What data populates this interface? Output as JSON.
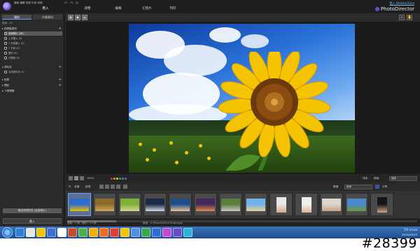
{
  "titlebar": {
    "menu_items": [
      "檔案",
      "編輯",
      "檢視",
      "外掛",
      "說明",
      "說明"
    ],
    "undo_glyphs": [
      "↶",
      "↷",
      "⟳"
    ],
    "modes": [
      "匯入",
      "調整",
      "編輯",
      "幻燈片",
      "列印"
    ],
    "active_mode": "匯入",
    "signin_label": "登入 DirectorZone",
    "brand_name": "PhotoDirector"
  },
  "left_panel": {
    "tabs": [
      "資料",
      "作業資料"
    ],
    "search_label": "搜尋：all",
    "sections": [
      {
        "label": "▸ 相簿監視夾",
        "items": [
          {
            "label": "全部相片 (28)",
            "selected": true
          },
          {
            "label": "上次匯入 (0)",
            "selected": false
          },
          {
            "label": "1 天前匯入 (0)",
            "selected": false
          },
          {
            "label": "7 天前 (0)",
            "selected": false
          },
          {
            "label": "歷史 (0)",
            "selected": false
          },
          {
            "label": "已刪除 (0)",
            "selected": false
          }
        ]
      },
      {
        "label": "▸ 資料夾",
        "items": [
          {
            "label": "共用資料夾 (1)",
            "selected": false
          }
        ]
      },
      {
        "label": "▸ 相簿",
        "items": []
      },
      {
        "label": "▸ 標記",
        "items": []
      },
      {
        "label": "▸ 人物標籤",
        "items": []
      }
    ],
    "bottom_button_1": "匯出到資料夾 (全部相片)",
    "bottom_button_2": "匯入"
  },
  "viewer_toolbar": {
    "view_buttons": [
      "▦",
      "▣",
      "▤"
    ],
    "right_buttons": [
      "⌕",
      "✋"
    ]
  },
  "filmstrip_toolbar": {
    "zoom_label": "100%",
    "sort_label": "排序：",
    "sort_value": "名稱",
    "view_label": "檢視",
    "group_label": "群組：",
    "group_value": "檔案",
    "search_label": "篩選",
    "search_placeholder": "搜尋",
    "facebook_label": "分享",
    "color_labels": [
      "#d83a3a",
      "#e59b2b",
      "#e4d33a",
      "#3fa94a",
      "#3a82d8",
      "#8a55c9"
    ]
  },
  "filmstrip": {
    "thumbnails": [
      {
        "name": "sunflower-thumb",
        "selected": true,
        "colors": [
          "#2d6bd0",
          "#f0c000"
        ]
      },
      {
        "name": "spiral-thumb",
        "selected": false,
        "colors": [
          "#8c6c2c",
          "#d0a85a"
        ]
      },
      {
        "name": "grass-thumb",
        "selected": false,
        "colors": [
          "#7fae3a",
          "#d6d98c"
        ]
      },
      {
        "name": "lake-thumb",
        "selected": false,
        "colors": [
          "#1a2a46",
          "#d7dce6"
        ]
      },
      {
        "name": "coast-thumb",
        "selected": false,
        "colors": [
          "#1e4d8b",
          "#e8c89a"
        ]
      },
      {
        "name": "sunset-thumb",
        "selected": false,
        "colors": [
          "#432a5a",
          "#e08a4a"
        ]
      },
      {
        "name": "bridge-thumb",
        "selected": false,
        "colors": [
          "#5a7f3a",
          "#c9c9c9"
        ]
      },
      {
        "name": "beach-thumb",
        "selected": false,
        "colors": [
          "#6fb3e8",
          "#e8d29a"
        ]
      },
      {
        "name": "portrait-1-thumb",
        "selected": false,
        "colors": [
          "#e8e8e8",
          "#d8a88a"
        ],
        "portrait": true
      },
      {
        "name": "portrait-2-thumb",
        "selected": false,
        "colors": [
          "#f0f0f0",
          "#e2b498"
        ],
        "portrait": true
      },
      {
        "name": "portrait-3-thumb",
        "selected": false,
        "colors": [
          "#dcd6cf",
          "#caa080"
        ]
      },
      {
        "name": "landscape-thumb",
        "selected": false,
        "colors": [
          "#4a88d0",
          "#6d9a3a"
        ]
      },
      {
        "name": "portrait-4-thumb",
        "selected": false,
        "colors": [
          "#151515",
          "#d2a58a"
        ],
        "portrait": true
      }
    ]
  },
  "status": {
    "left_text": "選取：1 張，顯示：13 張",
    "right_text": "路徑：C:\\Pictures\\Sun flower.jpg"
  },
  "taskbar": {
    "app_colors": [
      "#2f7fd8",
      "#e6e6e6",
      "#f2c400",
      "#3a6fcf",
      "#ffffff",
      "#c74b2a",
      "#4bb04b",
      "#f0b000",
      "#ec6d1a",
      "#e03c31",
      "#f2c400",
      "#4e8fe0",
      "#3aa84a",
      "#2f6bd0",
      "#c14ad0",
      "#6a4cc9",
      "#2bb3d8"
    ],
    "time": "下午 03:40",
    "date": "2014/10/15"
  },
  "watermark": "#28399"
}
